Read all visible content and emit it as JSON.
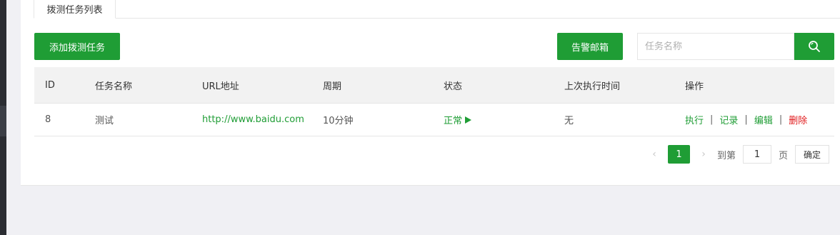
{
  "tab": {
    "label": "拨测任务列表"
  },
  "toolbar": {
    "add_label": "添加拨测任务",
    "alert_label": "告警邮箱",
    "search_placeholder": "任务名称",
    "search_icon": "search-icon"
  },
  "table": {
    "headers": [
      "ID",
      "任务名称",
      "URL地址",
      "周期",
      "状态",
      "上次执行时间",
      "操作"
    ],
    "rows": [
      {
        "id": "8",
        "name": "测试",
        "url": "http://www.baidu.com",
        "period": "10分钟",
        "status": "正常",
        "last_run": "无",
        "actions": {
          "run": "执行",
          "log": "记录",
          "edit": "编辑",
          "delete": "删除"
        }
      }
    ]
  },
  "pager": {
    "prev": "‹",
    "next": "›",
    "current": "1",
    "goto_label": "到第",
    "goto_value": "1",
    "unit": "页",
    "confirm": "确定"
  },
  "colors": {
    "accent": "#1f9d35",
    "danger": "#e0191b"
  }
}
